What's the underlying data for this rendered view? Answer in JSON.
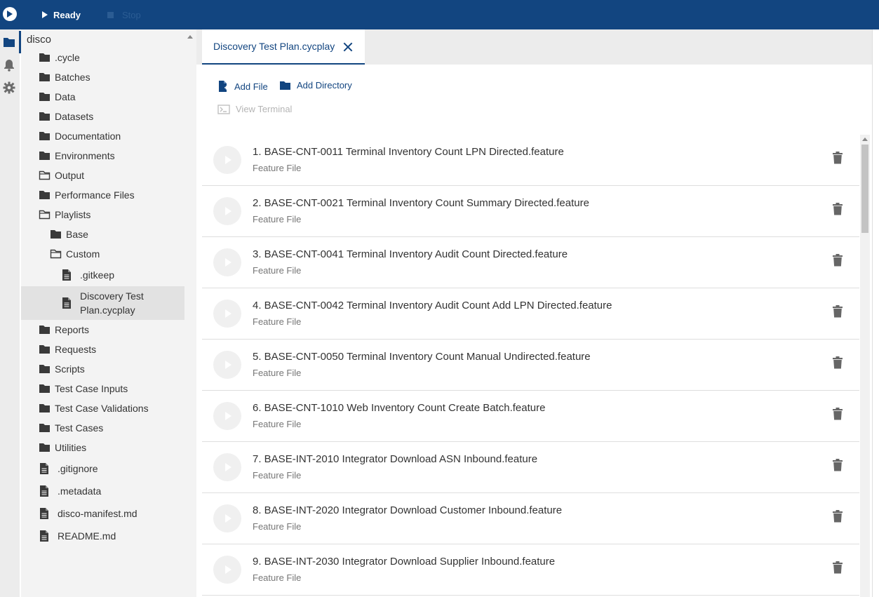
{
  "topbar": {
    "run_label": "Ready",
    "stop_label": "Stop",
    "brand_color": "#124580"
  },
  "rail": {
    "icons": [
      "folder-icon",
      "bell-icon",
      "gear-icon"
    ]
  },
  "sidebar": {
    "root": "disco",
    "items": [
      {
        "label": ".cycle",
        "type": "folder"
      },
      {
        "label": "Batches",
        "type": "folder"
      },
      {
        "label": "Data",
        "type": "folder"
      },
      {
        "label": "Datasets",
        "type": "folder"
      },
      {
        "label": "Documentation",
        "type": "folder"
      },
      {
        "label": "Environments",
        "type": "folder"
      },
      {
        "label": "Output",
        "type": "folder-open"
      },
      {
        "label": "Performance Files",
        "type": "folder"
      },
      {
        "label": "Playlists",
        "type": "folder-open"
      },
      {
        "label": "Base",
        "type": "folder"
      },
      {
        "label": "Custom",
        "type": "folder-open"
      },
      {
        "label": ".gitkeep",
        "type": "file"
      },
      {
        "label": "Discovery Test Plan.cycplay",
        "type": "file",
        "selected": true
      },
      {
        "label": "Reports",
        "type": "folder"
      },
      {
        "label": "Requests",
        "type": "folder"
      },
      {
        "label": "Scripts",
        "type": "folder"
      },
      {
        "label": "Test Case Inputs",
        "type": "folder"
      },
      {
        "label": "Test Case Validations",
        "type": "folder"
      },
      {
        "label": "Test Cases",
        "type": "folder"
      },
      {
        "label": "Utilities",
        "type": "folder"
      },
      {
        "label": ".gitignore",
        "type": "file"
      },
      {
        "label": ".metadata",
        "type": "file"
      },
      {
        "label": "disco-manifest.md",
        "type": "file"
      },
      {
        "label": "README.md",
        "type": "file"
      }
    ]
  },
  "tab": {
    "label": "Discovery Test Plan.cycplay"
  },
  "toolbar": {
    "add_file": "Add File",
    "add_directory": "Add Directory",
    "view_terminal": "View Terminal"
  },
  "playlist": [
    {
      "title": "1. BASE-CNT-0011 Terminal Inventory Count LPN Directed.feature",
      "subtitle": "Feature File"
    },
    {
      "title": "2. BASE-CNT-0021 Terminal Inventory Count Summary Directed.feature",
      "subtitle": "Feature File"
    },
    {
      "title": "3. BASE-CNT-0041 Terminal Inventory Audit Count Directed.feature",
      "subtitle": "Feature File"
    },
    {
      "title": "4. BASE-CNT-0042 Terminal Inventory Audit Count Add LPN Directed.feature",
      "subtitle": "Feature File"
    },
    {
      "title": "5. BASE-CNT-0050 Terminal Inventory Count Manual Undirected.feature",
      "subtitle": "Feature File"
    },
    {
      "title": "6. BASE-CNT-1010 Web Inventory Count Create Batch.feature",
      "subtitle": "Feature File"
    },
    {
      "title": "7. BASE-INT-2010 Integrator Download ASN Inbound.feature",
      "subtitle": "Feature File"
    },
    {
      "title": "8. BASE-INT-2020 Integrator Download Customer Inbound.feature",
      "subtitle": "Feature File"
    },
    {
      "title": "9. BASE-INT-2030 Integrator Download Supplier Inbound.feature",
      "subtitle": "Feature File"
    }
  ]
}
